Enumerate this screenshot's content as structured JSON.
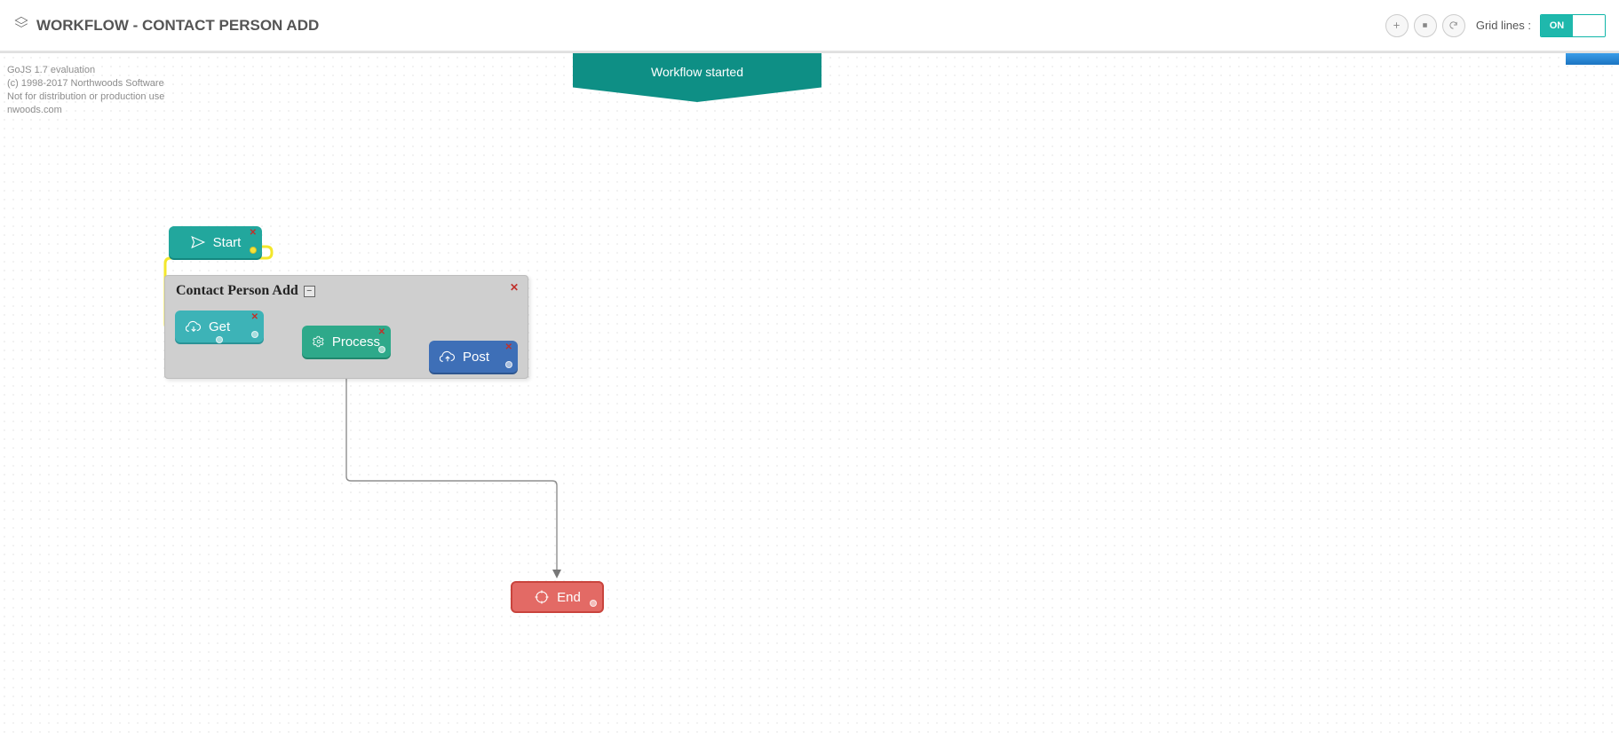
{
  "header": {
    "title": "WORKFLOW - CONTACT PERSON ADD",
    "grid_label": "Grid lines :",
    "toggle_on": "ON"
  },
  "banner": {
    "label": "Workflow started"
  },
  "watermark": {
    "l1": "GoJS 1.7 evaluation",
    "l2": "(c) 1998-2017 Northwoods Software",
    "l3": "Not for distribution or production use",
    "l4": "nwoods.com"
  },
  "group": {
    "title": "Contact Person Add"
  },
  "nodes": {
    "start": "Start",
    "get": "Get",
    "process": "Process",
    "post": "Post",
    "end": "End"
  }
}
